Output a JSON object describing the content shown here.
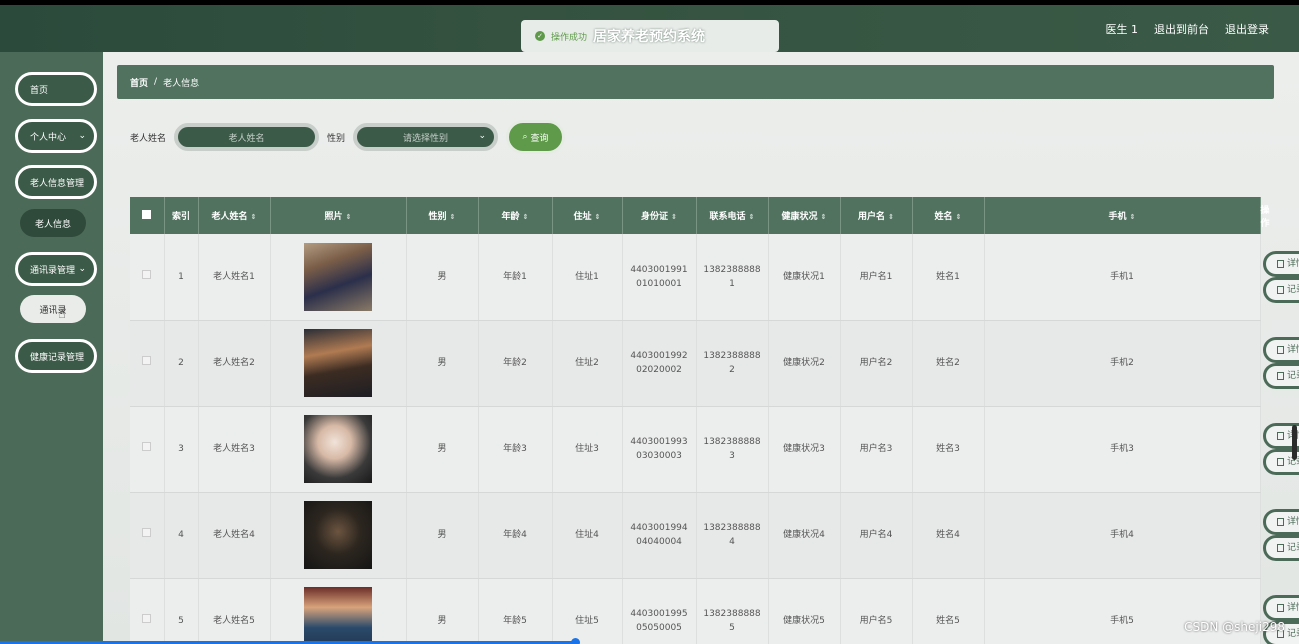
{
  "header": {
    "toast_text": "操作成功",
    "system_title": "居家养老预约系统",
    "user": "医生 1",
    "back_front": "退出到前台",
    "logout": "退出登录"
  },
  "sidebar": {
    "items": [
      {
        "label": "首页"
      },
      {
        "label": "个人中心"
      },
      {
        "label": "老人信息管理"
      },
      {
        "label": "老人信息"
      },
      {
        "label": "通讯录管理"
      },
      {
        "label": "通讯录"
      },
      {
        "label": "健康记录管理"
      }
    ]
  },
  "breadcrumb": {
    "home": "首页",
    "sep": "/",
    "current": "老人信息"
  },
  "search": {
    "name_label": "老人姓名",
    "name_placeholder": "老人姓名",
    "gender_label": "性别",
    "gender_placeholder": "请选择性别",
    "button": "查询"
  },
  "table": {
    "headers": [
      "索引",
      "老人姓名",
      "照片",
      "性别",
      "年龄",
      "住址",
      "身份证",
      "联系电话",
      "健康状况",
      "用户名",
      "姓名",
      "手机",
      "操作"
    ],
    "rows": [
      {
        "index": "1",
        "name": "老人姓名1",
        "gender": "男",
        "age": "年龄1",
        "address": "住址1",
        "id_card": "440300199101010001",
        "phone": "13823888881",
        "health": "健康状况1",
        "username": "用户名1",
        "realname": "姓名1",
        "mobile": "手机1"
      },
      {
        "index": "2",
        "name": "老人姓名2",
        "gender": "男",
        "age": "年龄2",
        "address": "住址2",
        "id_card": "440300199202020002",
        "phone": "13823888882",
        "health": "健康状况2",
        "username": "用户名2",
        "realname": "姓名2",
        "mobile": "手机2"
      },
      {
        "index": "3",
        "name": "老人姓名3",
        "gender": "男",
        "age": "年龄3",
        "address": "住址3",
        "id_card": "440300199303030003",
        "phone": "13823888883",
        "health": "健康状况3",
        "username": "用户名3",
        "realname": "姓名3",
        "mobile": "手机3"
      },
      {
        "index": "4",
        "name": "老人姓名4",
        "gender": "男",
        "age": "年龄4",
        "address": "住址4",
        "id_card": "440300199404040004",
        "phone": "13823888884",
        "health": "健康状况4",
        "username": "用户名4",
        "realname": "姓名4",
        "mobile": "手机4"
      },
      {
        "index": "5",
        "name": "老人姓名5",
        "gender": "男",
        "age": "年龄5",
        "address": "住址5",
        "id_card": "440300199505050005",
        "phone": "13823888885",
        "health": "健康状况5",
        "username": "用户名5",
        "realname": "姓名5",
        "mobile": "手机5"
      }
    ],
    "actions": {
      "detail": "详情",
      "record": "记录"
    }
  },
  "watermark": "CSDN @sheji298",
  "colors": {
    "theme": "#4b6a57",
    "accent": "#5e9a49",
    "header": "#527260"
  }
}
